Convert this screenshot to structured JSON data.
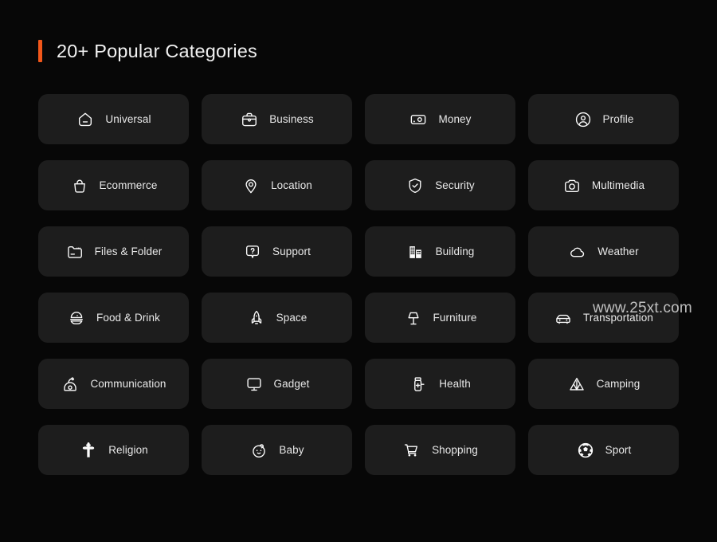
{
  "header": {
    "title": "20+ Popular Categories",
    "accent_color": "#f2571a"
  },
  "theme": {
    "page_background": "#070707",
    "card_background": "#1d1d1d",
    "icon_color": "#fbfbfb",
    "label_color": "#e8e8e8"
  },
  "watermark": {
    "text": "www.25xt.com"
  },
  "grid": {
    "columns": 4,
    "rows": 6,
    "items": [
      {
        "label": "Universal",
        "icon": "home-icon"
      },
      {
        "label": "Business",
        "icon": "briefcase-icon"
      },
      {
        "label": "Money",
        "icon": "banknote-icon"
      },
      {
        "label": "Profile",
        "icon": "user-circle-icon"
      },
      {
        "label": "Ecommerce",
        "icon": "shopping-bag-icon"
      },
      {
        "label": "Location",
        "icon": "map-pin-icon"
      },
      {
        "label": "Security",
        "icon": "shield-check-icon"
      },
      {
        "label": "Multimedia",
        "icon": "camera-icon"
      },
      {
        "label": "Files & Folder",
        "icon": "folder-icon"
      },
      {
        "label": "Support",
        "icon": "question-bubble-icon"
      },
      {
        "label": "Building",
        "icon": "building-icon"
      },
      {
        "label": "Weather",
        "icon": "cloud-icon"
      },
      {
        "label": "Food & Drink",
        "icon": "burger-icon"
      },
      {
        "label": "Space",
        "icon": "rocket-icon"
      },
      {
        "label": "Furniture",
        "icon": "lamp-icon"
      },
      {
        "label": "Transportation",
        "icon": "car-icon"
      },
      {
        "label": "Communication",
        "icon": "telephone-icon"
      },
      {
        "label": "Gadget",
        "icon": "monitor-icon"
      },
      {
        "label": "Health",
        "icon": "medicine-bottle-icon"
      },
      {
        "label": "Camping",
        "icon": "tent-icon"
      },
      {
        "label": "Religion",
        "icon": "cross-icon"
      },
      {
        "label": "Baby",
        "icon": "baby-face-icon"
      },
      {
        "label": "Shopping",
        "icon": "shopping-cart-icon"
      },
      {
        "label": "Sport",
        "icon": "soccer-ball-icon"
      }
    ]
  }
}
